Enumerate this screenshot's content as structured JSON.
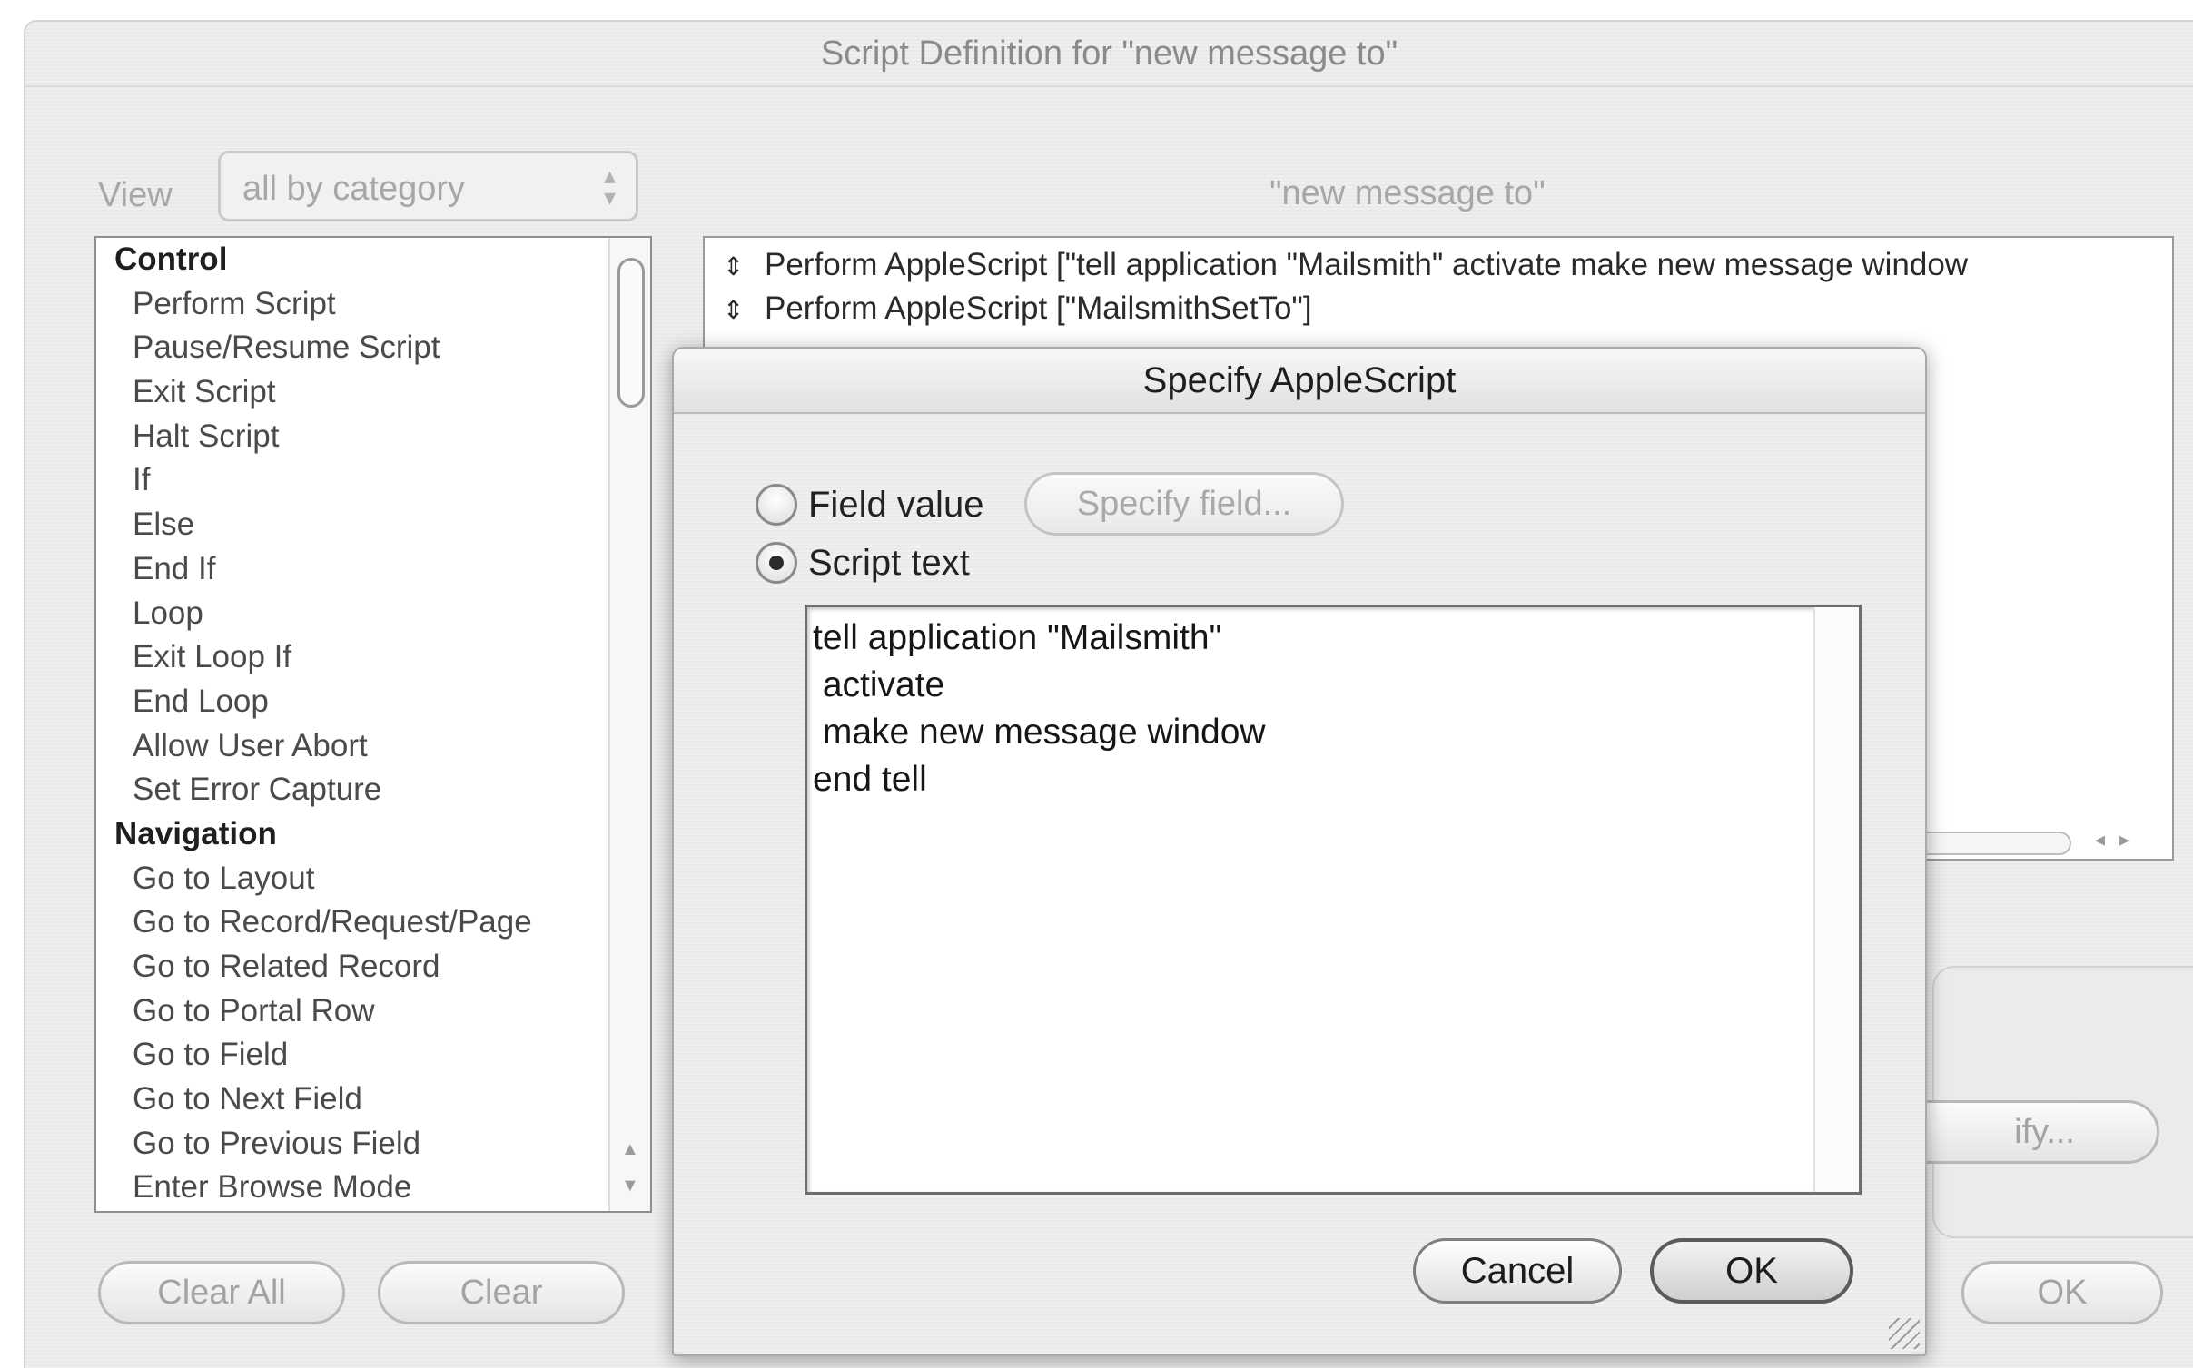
{
  "main_window": {
    "title": "Script Definition for \"new message to\"",
    "view_label": "View",
    "view_value": "all by category",
    "script_name": "\"new message to\"",
    "steps": [
      {
        "label": "Control",
        "category": true
      },
      {
        "label": "Perform Script"
      },
      {
        "label": "Pause/Resume Script"
      },
      {
        "label": "Exit Script"
      },
      {
        "label": "Halt Script"
      },
      {
        "label": "If"
      },
      {
        "label": "Else"
      },
      {
        "label": "End If"
      },
      {
        "label": "Loop"
      },
      {
        "label": "Exit Loop If"
      },
      {
        "label": "End Loop"
      },
      {
        "label": "Allow User Abort"
      },
      {
        "label": "Set Error Capture"
      },
      {
        "label": "Navigation",
        "category": true
      },
      {
        "label": "Go to Layout"
      },
      {
        "label": "Go to Record/Request/Page"
      },
      {
        "label": "Go to Related Record"
      },
      {
        "label": "Go to Portal Row"
      },
      {
        "label": "Go to Field"
      },
      {
        "label": "Go to Next Field"
      },
      {
        "label": "Go to Previous Field"
      },
      {
        "label": "Enter Browse Mode"
      }
    ],
    "script_lines": [
      "Perform AppleScript [\"tell application \"Mailsmith\" activate make new message window",
      "Perform AppleScript [\"MailsmithSetTo\"]"
    ],
    "clear_all_label": "Clear All",
    "clear_label": "Clear",
    "specify_partial_label": "ify...",
    "ok_label": "OK"
  },
  "sheet": {
    "title": "Specify AppleScript",
    "field_value_label": "Field value",
    "specify_field_label": "Specify field...",
    "script_text_label": "Script text",
    "script_text_selected": true,
    "script_text": "tell application \"Mailsmith\"\n activate\n make new message window\nend tell",
    "cancel_label": "Cancel",
    "ok_label": "OK"
  }
}
